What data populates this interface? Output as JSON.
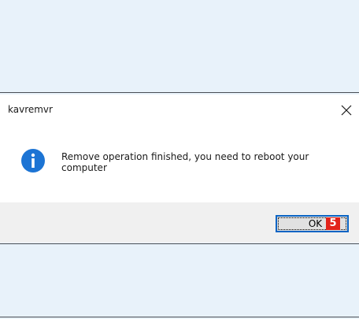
{
  "dialog": {
    "title": "kavremvr",
    "message": "Remove operation finished, you need to reboot your computer",
    "icon": "info-icon",
    "ok_label": "OK",
    "step_badge": "5"
  },
  "colors": {
    "info_blue": "#1c74d4",
    "badge_red": "#e2231a",
    "button_border": "#0a64c4",
    "footer_bg": "#f0f0f0"
  }
}
